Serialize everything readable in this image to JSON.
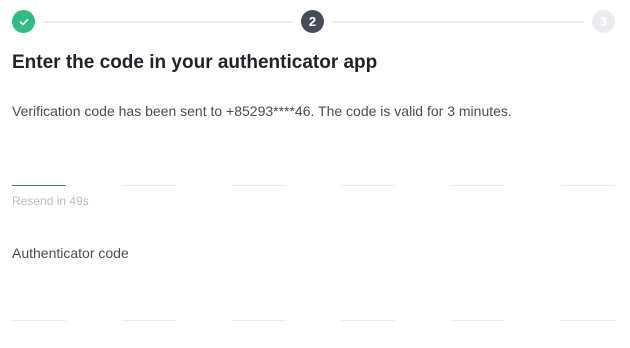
{
  "stepper": {
    "steps": [
      {
        "label": "",
        "state": "completed",
        "icon": "check-icon"
      },
      {
        "label": "2",
        "state": "current"
      },
      {
        "label": "3",
        "state": "upcoming"
      }
    ]
  },
  "title": "Enter the code in your authenticator app",
  "subtitle": "Verification code has been sent to +85293****46. The code is valid for 3 minutes.",
  "sms_code": {
    "digits": [
      "",
      "",
      "",
      "",
      "",
      ""
    ],
    "active_index": 0,
    "resend_text": "Resend in 49s"
  },
  "authenticator": {
    "label": "Authenticator code",
    "digits": [
      "",
      "",
      "",
      "",
      "",
      ""
    ]
  },
  "colors": {
    "completed": "#2ebd85",
    "current": "#474d57",
    "upcoming": "#eaecef",
    "active_underline": "#3375bb",
    "underline": "#eaecef"
  }
}
